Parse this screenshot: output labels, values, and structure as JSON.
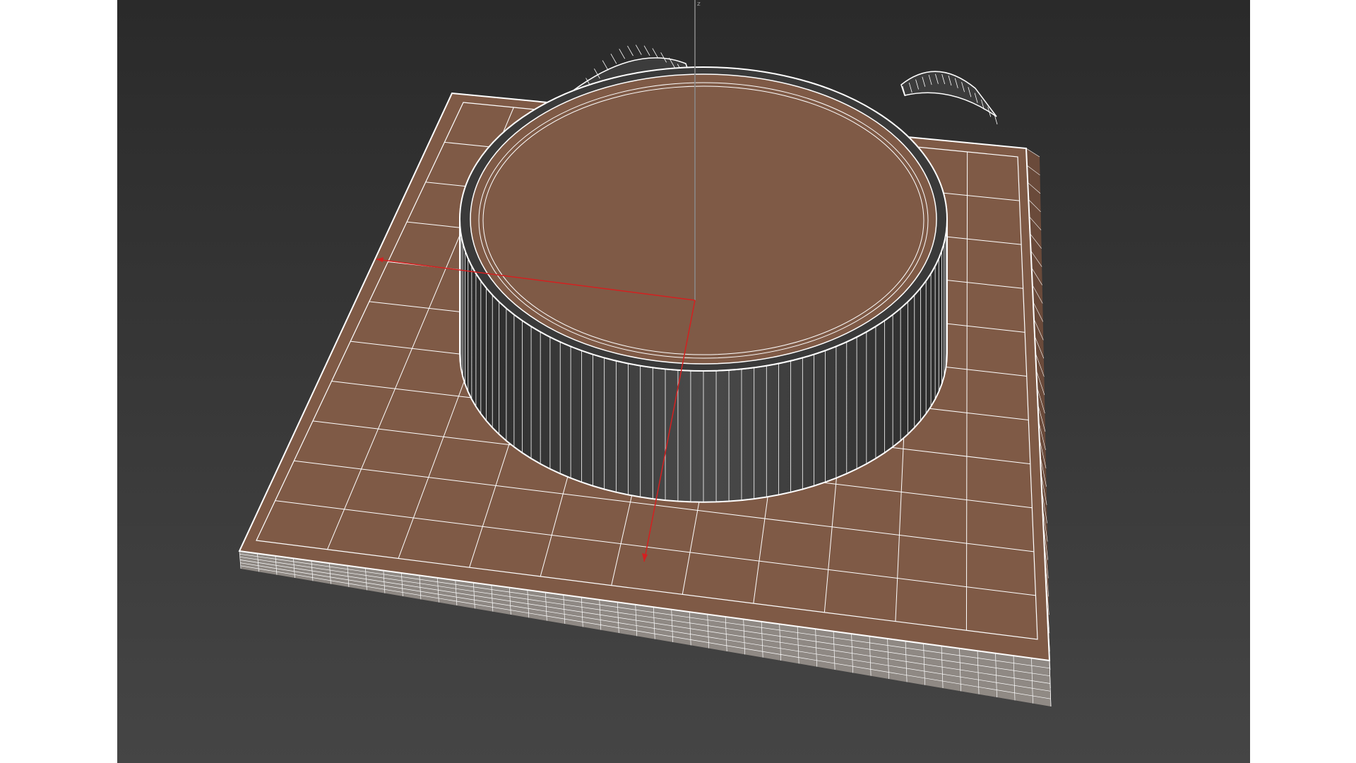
{
  "viewport": {
    "background_top": "#2a2a2a",
    "background_bottom": "#454545",
    "object_color": "#7f5a46",
    "wire_color": "#ffffff",
    "wall_color": "#3a3a3a",
    "gizmo_x_color": "#d42020",
    "gizmo_z_color": "#8a8a8a",
    "z_axis_label": "z"
  }
}
